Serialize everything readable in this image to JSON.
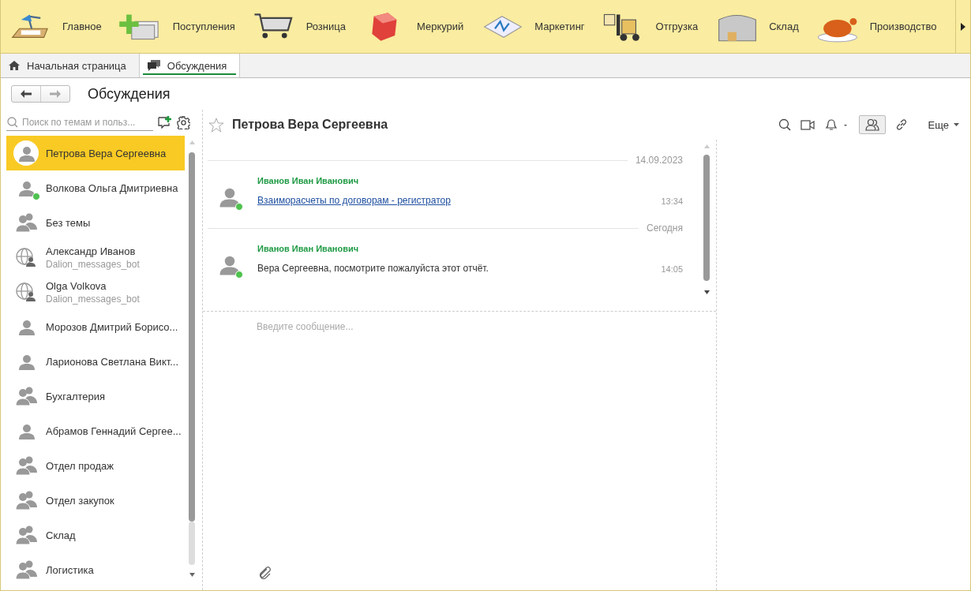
{
  "sections": [
    {
      "label": "Главное"
    },
    {
      "label": "Поступления"
    },
    {
      "label": "Розница"
    },
    {
      "label": "Меркурий"
    },
    {
      "label": "Маркетинг"
    },
    {
      "label": "Отгрузка"
    },
    {
      "label": "Склад"
    },
    {
      "label": "Производство"
    }
  ],
  "open_tabs": [
    {
      "label": "Начальная страница",
      "kind": "home",
      "selected": false
    },
    {
      "label": "Обсуждения",
      "kind": "discussions",
      "selected": true
    }
  ],
  "page_title": "Обсуждения",
  "search": {
    "placeholder": "Поиск по темам и польз..."
  },
  "conversations": [
    {
      "kind": "person",
      "name": "Петрова Вера Сергеевна",
      "selected": true,
      "online": false
    },
    {
      "kind": "person",
      "name": "Волкова Ольга Дмитриевна",
      "selected": false,
      "online": true
    },
    {
      "kind": "group",
      "name": "Без темы",
      "selected": false,
      "online": false
    },
    {
      "kind": "bot",
      "name": "Александр Иванов",
      "subtitle": "Dalion_messages_bot",
      "selected": false,
      "online": false
    },
    {
      "kind": "bot",
      "name": "Olga Volkova",
      "subtitle": "Dalion_messages_bot",
      "selected": false,
      "online": false
    },
    {
      "kind": "person",
      "name": "Морозов Дмитрий Борисо...",
      "selected": false,
      "online": false
    },
    {
      "kind": "person",
      "name": "Ларионова Светлана Викт...",
      "selected": false,
      "online": false
    },
    {
      "kind": "group",
      "name": "Бухгалтерия",
      "selected": false,
      "online": false
    },
    {
      "kind": "person",
      "name": "Абрамов Геннадий Сергее...",
      "selected": false,
      "online": false
    },
    {
      "kind": "group",
      "name": "Отдел продаж",
      "selected": false,
      "online": false
    },
    {
      "kind": "group",
      "name": "Отдел закупок",
      "selected": false,
      "online": false
    },
    {
      "kind": "group",
      "name": "Склад",
      "selected": false,
      "online": false
    },
    {
      "kind": "group",
      "name": "Логистика",
      "selected": false,
      "online": false
    }
  ],
  "chat": {
    "title": "Петрова Вера Сергеевна",
    "favorite": false,
    "members_pressed": true,
    "more_label": "Еще",
    "feed": [
      {
        "kind": "date",
        "text": "14.09.2023"
      },
      {
        "kind": "message",
        "author": "Иванов Иван Иванович",
        "online": true,
        "is_link": true,
        "text": "Взаиморасчеты по договорам - регистратор",
        "time": "13:34"
      },
      {
        "kind": "date",
        "text": "Сегодня"
      },
      {
        "kind": "message",
        "author": "Иванов Иван Иванович",
        "online": true,
        "is_link": false,
        "text": "Вера Сергеевна, посмотрите пожалуйста этот отчёт.",
        "time": "14:05"
      }
    ],
    "input_placeholder": "Введите сообщение..."
  }
}
